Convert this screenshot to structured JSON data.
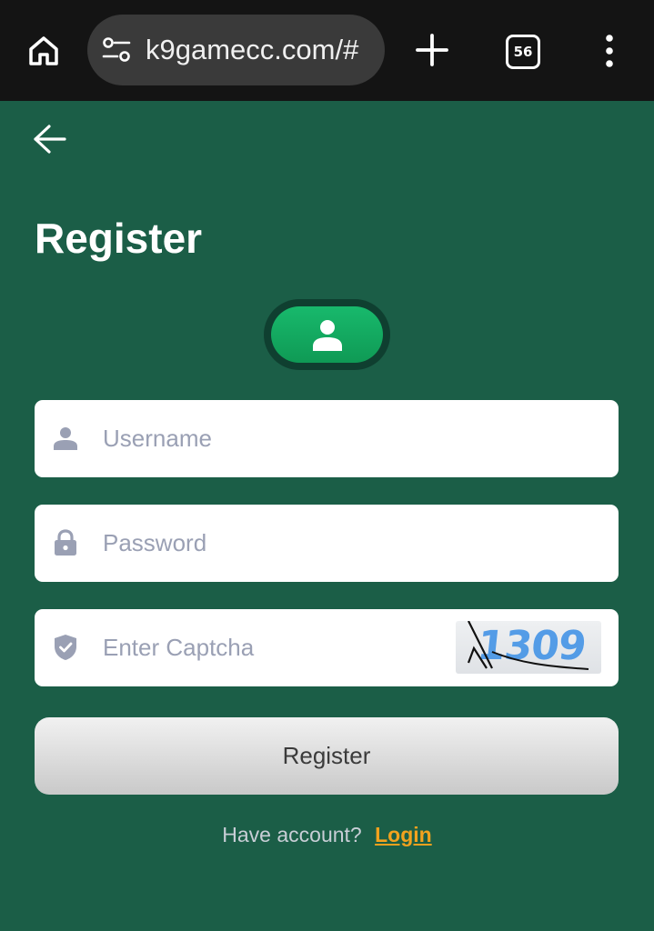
{
  "browser": {
    "url": "k9gamecc.com/#",
    "tab_count": "56",
    "icons": {
      "home": "home-icon",
      "site_settings": "site-settings-icon",
      "new_tab": "plus-icon",
      "tabs": "tab-switcher-icon",
      "menu": "more-vert-icon"
    }
  },
  "page": {
    "title": "Register",
    "back_icon": "arrow-left-icon",
    "account_icon": "person-icon"
  },
  "form": {
    "username": {
      "placeholder": "Username",
      "value": "",
      "icon": "person-icon"
    },
    "password": {
      "placeholder": "Password",
      "value": "",
      "icon": "lock-icon"
    },
    "captcha": {
      "placeholder": "Enter Captcha",
      "value": "",
      "icon": "shield-check-icon",
      "image_text": "1309"
    },
    "submit_label": "Register"
  },
  "footer": {
    "prompt": "Have account?",
    "login_label": "Login"
  },
  "colors": {
    "background": "#1b5e47",
    "accent_green": "#12a65e",
    "link_orange": "#f2a21e",
    "placeholder": "#9aa0b4"
  }
}
